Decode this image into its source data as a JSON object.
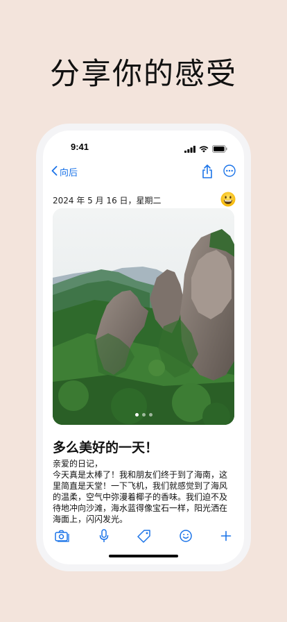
{
  "headline": "分享你的感受",
  "status_bar": {
    "time": "9:41",
    "icons": [
      "signal-icon",
      "wifi-icon",
      "battery-icon"
    ]
  },
  "navbar": {
    "back_label": "向后",
    "icons": [
      "chevron-left-icon",
      "share-icon",
      "more-icon"
    ]
  },
  "entry": {
    "date": "2024 年 5 月 16 日，星期二",
    "mood_icon": "smiley-emoji-icon",
    "photo_pages": 3,
    "photo_current": 1,
    "title": "多么美好的一天！",
    "body_lines": [
      "亲爱的日记，",
      "今天真是太棒了！我和朋友们终于到了海南，这",
      "里简直是天堂！一下飞机，我们就感觉到了海风",
      "的温柔，空气中弥漫着椰子的香味。我们迫不及",
      "待地冲向沙滩，海水蓝得像宝石一样，阳光洒在",
      "海面上，闪闪发光。"
    ]
  },
  "toolbar": {
    "icons": [
      "camera-icon",
      "microphone-icon",
      "tag-icon",
      "smiley-icon",
      "plus-icon"
    ]
  },
  "colors": {
    "background": "#f3e4dc",
    "accent": "#1a73e8",
    "text": "#111111"
  }
}
